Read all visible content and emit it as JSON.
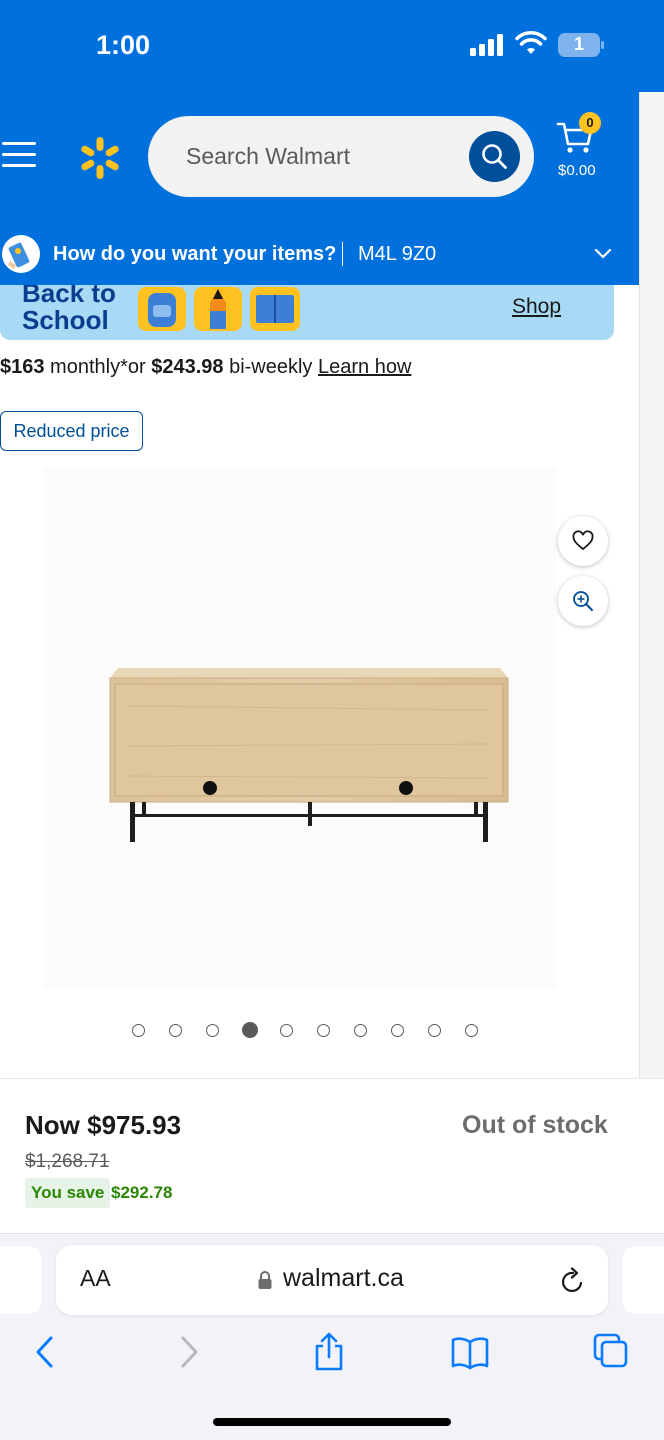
{
  "status_bar": {
    "time": "1:00",
    "battery": "1"
  },
  "header": {
    "search": {
      "placeholder": "Search Walmart"
    },
    "cart": {
      "count": "0",
      "total": "$0.00"
    },
    "delivery": {
      "question": "How do you want your items?",
      "postal_code": "M4L 9Z0"
    }
  },
  "banner": {
    "title_line1": "Back to",
    "title_line2": "School",
    "link": "Shop"
  },
  "financing": {
    "monthly_amount": "$163",
    "monthly_text": " monthly*or ",
    "biweekly_amount": "$243.98",
    "biweekly_text": " bi-weekly ",
    "learn_link": "Learn how"
  },
  "badge": {
    "label": "Reduced price"
  },
  "gallery": {
    "image_count": 10,
    "active_index": 3
  },
  "pricing": {
    "now": "Now $975.93",
    "was": "$1,268.71",
    "you_save_label": "You save",
    "you_save_amount": "$292.78",
    "stock_status": "Out of stock"
  },
  "browser": {
    "aa_label": "AA",
    "url": "walmart.ca"
  },
  "colors": {
    "walmart_blue": "#0071dc",
    "dark_blue": "#004f9a",
    "spark_yellow": "#ffc220",
    "save_green": "#2a8703"
  }
}
